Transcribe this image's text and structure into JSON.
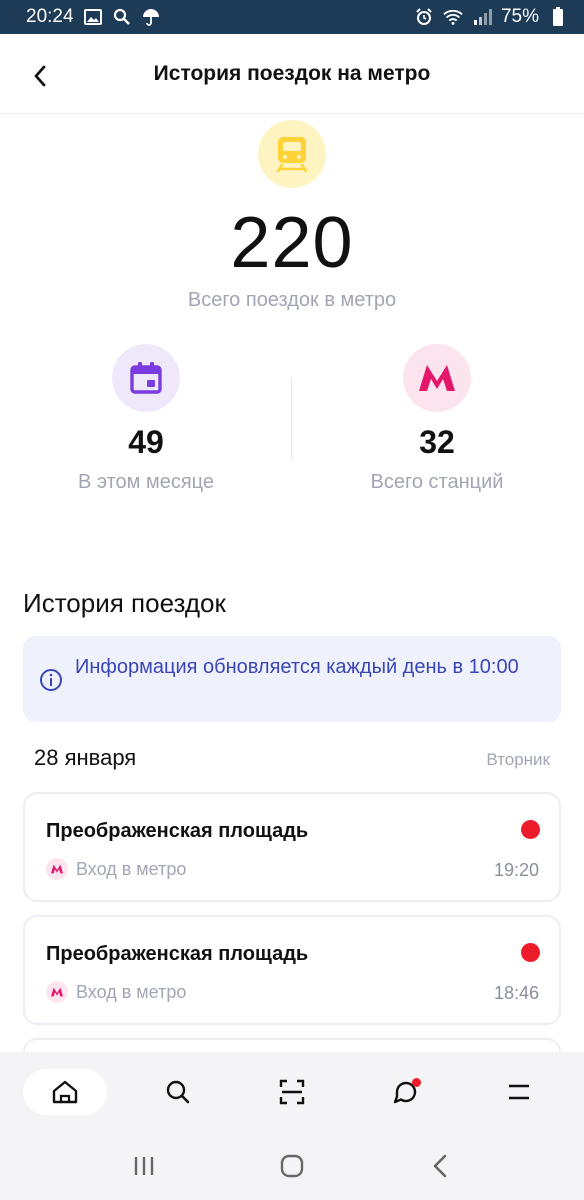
{
  "status_bar": {
    "time": "20:24",
    "battery": "75%"
  },
  "header": {
    "title": "История поездок на метро"
  },
  "summary": {
    "total_trips": "220",
    "total_label": "Всего поездок в метро",
    "month_trips": "49",
    "month_label": "В этом месяце",
    "stations": "32",
    "stations_label": "Всего станций"
  },
  "history": {
    "title": "История поездок",
    "info": "Информация обновляется каждый день в 10:00",
    "date": "28 января",
    "weekday": "Вторник",
    "trips": [
      {
        "station": "Преображенская площадь",
        "type": "Вход в метро",
        "time": "19:20"
      },
      {
        "station": "Преображенская площадь",
        "type": "Вход в метро",
        "time": "18:46"
      }
    ]
  },
  "colors": {
    "accent_red": "#ee1c2b",
    "metro_pink": "#e5176b",
    "calendar_purple": "#7a3ce0",
    "info_blue": "#3a46b7"
  },
  "bottom_nav": [
    "home-icon",
    "search-icon",
    "scan-icon",
    "chat-icon",
    "menu-icon"
  ]
}
